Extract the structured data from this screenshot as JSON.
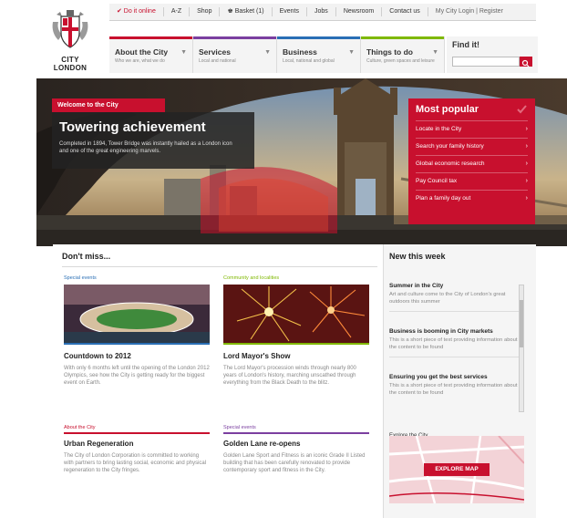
{
  "topbar": {
    "items": [
      "✔ Do it online",
      "A-Z",
      "Shop",
      "♚ Basket (1)",
      "Events",
      "Jobs",
      "Newsroom",
      "Contact us"
    ],
    "account": "My City Login | Register"
  },
  "logo": {
    "line1": "CITY",
    "line2": "LONDON"
  },
  "nav": {
    "items": [
      {
        "label": "About the City",
        "sub": "Who we are, what we do",
        "color": "#c8102e"
      },
      {
        "label": "Services",
        "sub": "Local and national",
        "color": "#7b3fa0"
      },
      {
        "label": "Business",
        "sub": "Local, national and global",
        "color": "#2a6fb5"
      },
      {
        "label": "Things to do",
        "sub": "Culture, green spaces and leisure",
        "color": "#7fb800"
      }
    ],
    "find_label": "Find it!",
    "find_placeholder": ""
  },
  "hero": {
    "badge": "Welcome to the City",
    "title": "Towering achievement",
    "desc": "Completed in 1894, Tower Bridge was instantly hailed as a London icon and one of the great engineering marvels."
  },
  "popular": {
    "title": "Most popular",
    "items": [
      "Locate in the City",
      "Search your family history",
      "Global economic research",
      "Pay Council tax",
      "Plan a family day out"
    ]
  },
  "dontmiss": {
    "title": "Don't miss...",
    "cards": [
      {
        "category": "Special events",
        "cat_color": "#2a6fb5",
        "title": "Countdown to 2012",
        "desc": "With only 6 months left until the opening of the London 2012 Olympics, see how the City is getting ready for the biggest event on Earth."
      },
      {
        "category": "Community and localities",
        "cat_color": "#7fb800",
        "title": "Lord Mayor's Show",
        "desc": "The Lord Mayor's procession winds through nearly 800 years of London's history, marching unscathed through everything from the Black Death to the blitz."
      },
      {
        "category": "About the City",
        "cat_color": "#c8102e",
        "title": "Urban Regeneration",
        "desc": "The City of London Corporation is committed to working with partners to bring lasting social, economic and physical regeneration to the City fringes."
      },
      {
        "category": "Special events",
        "cat_color": "#7b3fa0",
        "title": "Golden Lane re-opens",
        "desc": "Golden Lane Sport and Fitness is an iconic Grade II Listed building that has been carefully renovated to provide contemporary sport and fitness in the City."
      }
    ]
  },
  "newthisweek": {
    "title": "New this week",
    "items": [
      {
        "title": "Summer in the City",
        "desc": "Art and culture come to the City of London's great outdoors this summer"
      },
      {
        "title": "Business is booming in City markets",
        "desc": "This is a short piece of text providing information about the content to be found"
      },
      {
        "title": "Ensuring you get the best services",
        "desc": "This is a short piece of text providing information about the content to be found"
      }
    ],
    "explore_label": "Explore the City",
    "explore_button": "EXPLORE MAP"
  },
  "colors": {
    "brand_red": "#c8102e",
    "dark_panel": "#232323"
  }
}
